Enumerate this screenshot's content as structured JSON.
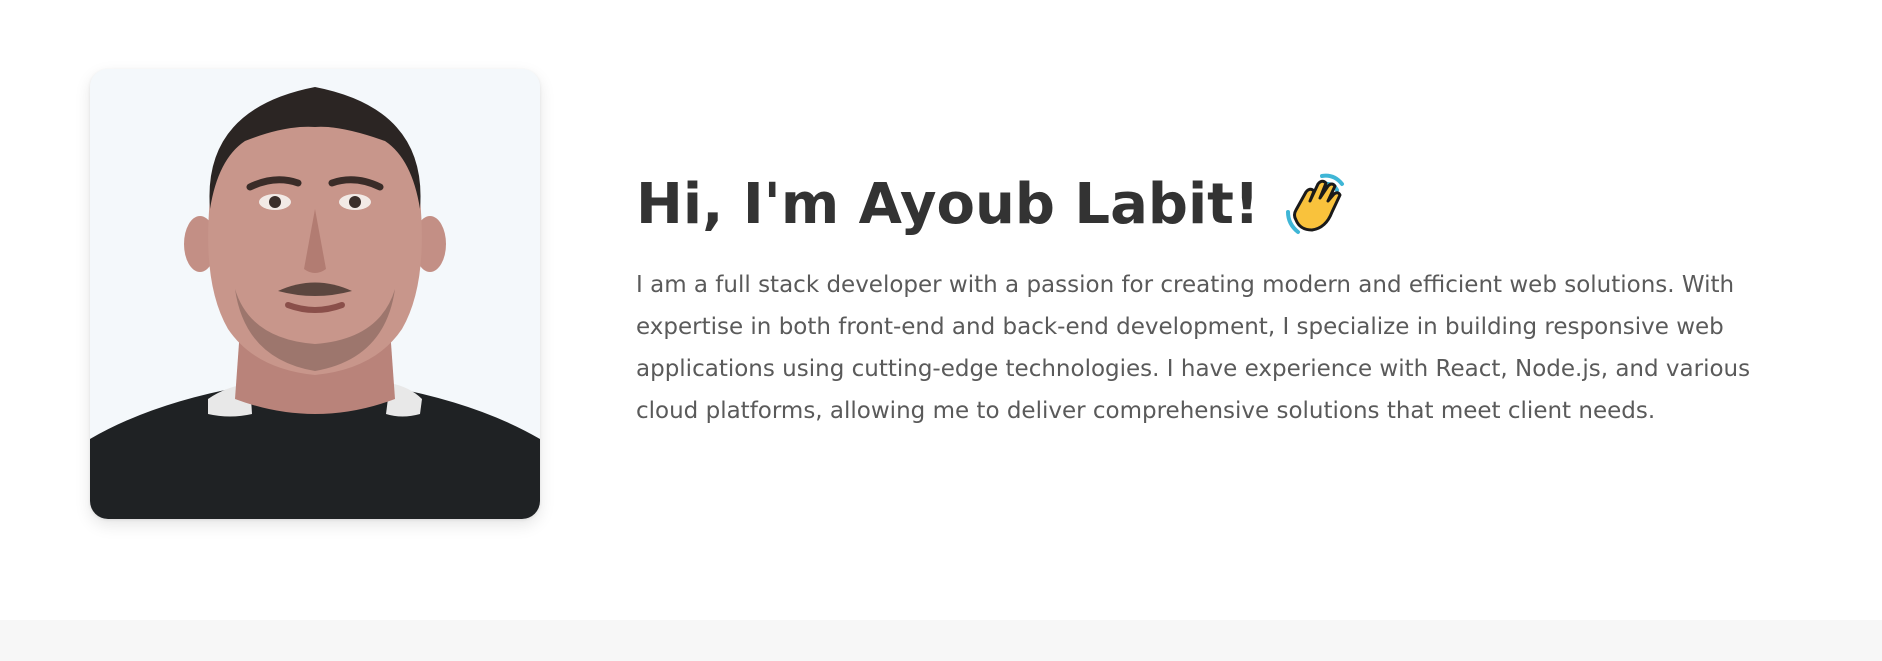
{
  "hero": {
    "avatar_icon": "profile-photo",
    "title": "Hi, I'm Ayoub Labit!",
    "wave_icon": "waving-hand-icon",
    "bio": "I am a full stack developer with a passion for creating modern and efficient web solutions. With expertise in both front-end and back-end development, I specialize in building responsive web applications using cutting-edge technologies. I have experience with React, Node.js, and various cloud platforms, allowing me to deliver comprehensive solutions that meet client needs."
  },
  "colors": {
    "title": "#333333",
    "body_text": "#5a5a5a",
    "photo_background": "#f4f8fb",
    "footer_band": "#f7f7f7"
  }
}
